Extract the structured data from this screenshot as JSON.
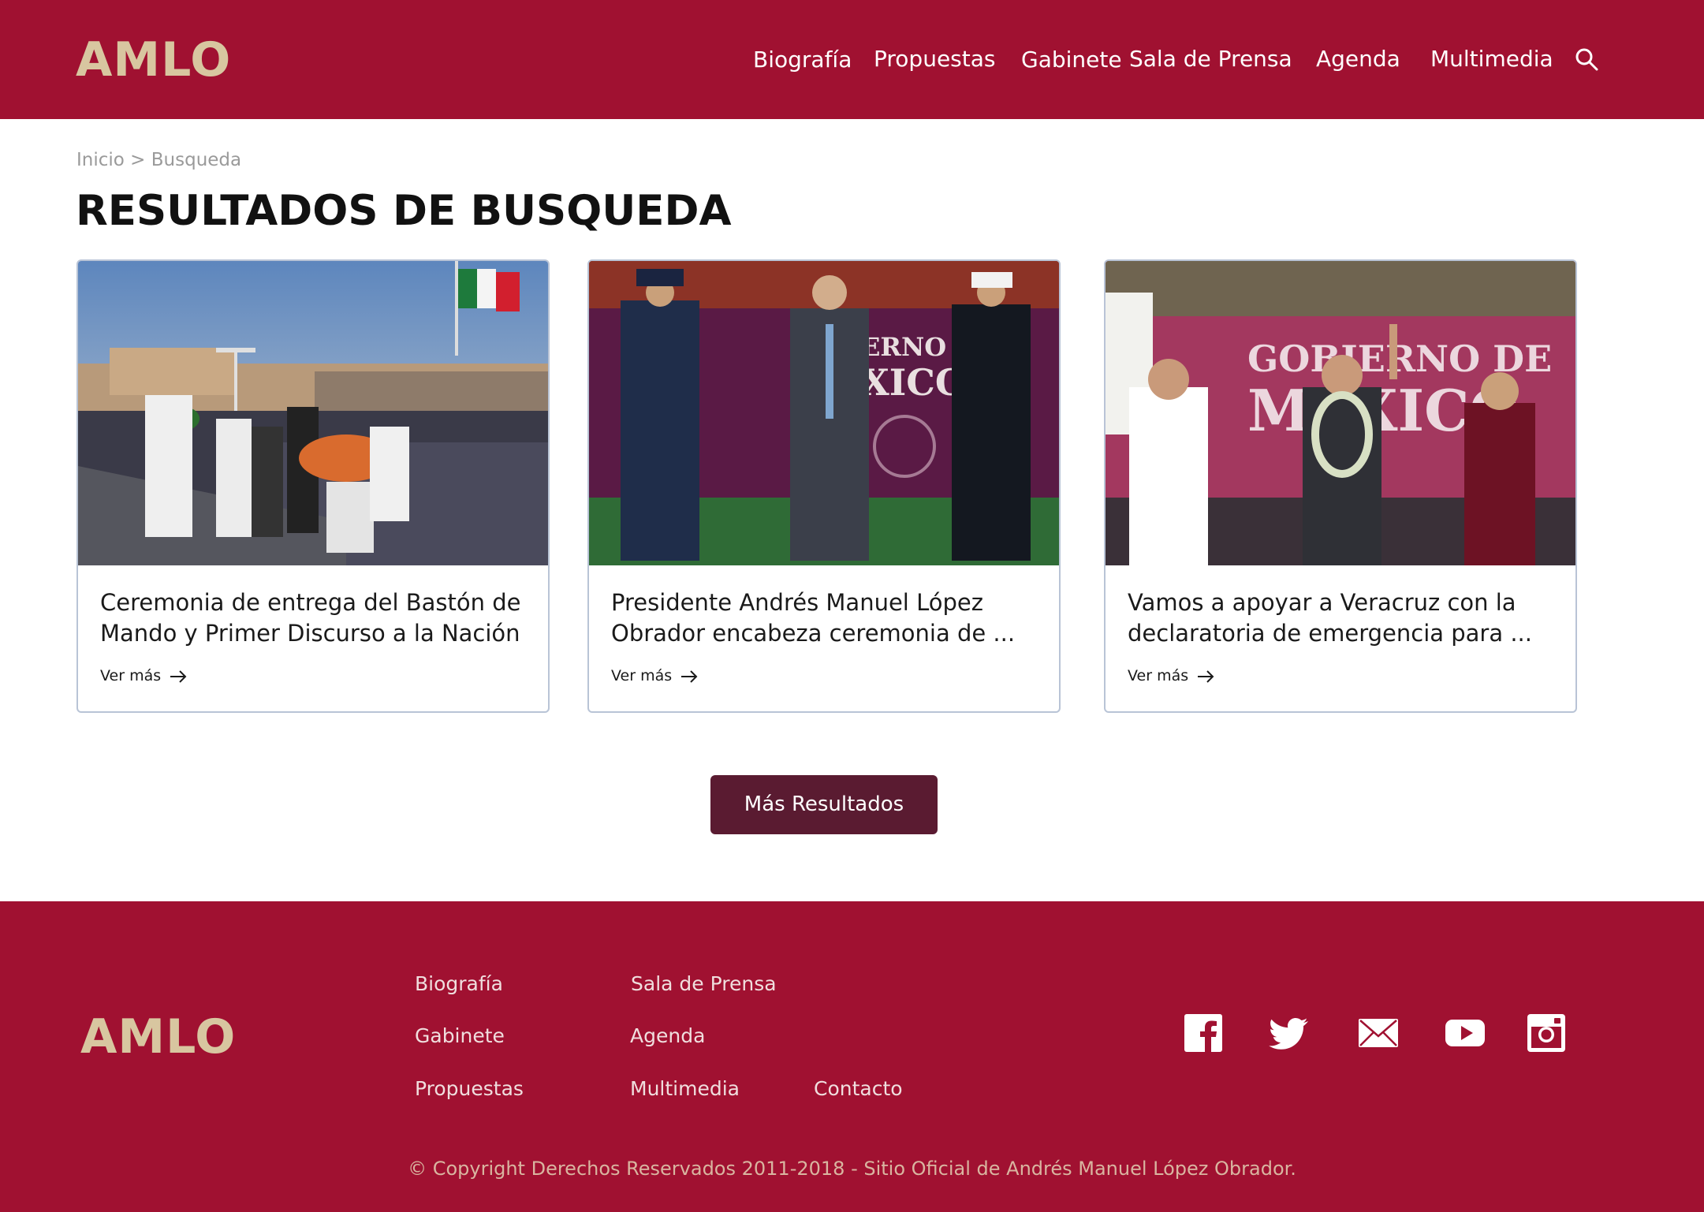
{
  "header": {
    "logo": "AMLO",
    "nav": [
      "Biografía",
      "Propuestas",
      "Gabinete",
      "Sala de Prensa",
      "Agenda",
      "Multimedia"
    ]
  },
  "breadcrumb": {
    "home": "Inicio",
    "separator": ">",
    "current": "Busqueda"
  },
  "page_title": "RESULTADOS DE BUSQUEDA",
  "cards": [
    {
      "title": "Ceremonia de entrega del Bastón de Mando y Primer Discurso a la Nación",
      "link": "Ver más"
    },
    {
      "title": "Presidente Andrés Manuel López Obrador encabeza ceremonia de ...",
      "link": "Ver más"
    },
    {
      "title": "Vamos a apoyar a Veracruz con la declaratoria de emergencia para ...",
      "link": "Ver más"
    }
  ],
  "card_image_texts": {
    "card2_banner": "ERNO D\nXICO",
    "card3_banner": "GOBIERNO DE\nMEXICO"
  },
  "more_button": "Más Resultados",
  "footer": {
    "logo": "AMLO",
    "links": [
      "Biografía",
      "Sala de Prensa",
      "Gabinete",
      "Agenda",
      "Propuestas",
      "Multimedia",
      "Contacto"
    ],
    "social": [
      "facebook-icon",
      "twitter-icon",
      "mail-icon",
      "youtube-icon",
      "instagram-icon"
    ],
    "copyright": "© Copyright Derechos Reservados 2011-2018 - Sitio Oficial de Andrés Manuel López Obrador."
  },
  "colors": {
    "brand": "#a01131",
    "logo": "#d8c6a0",
    "button": "#5a1b31"
  }
}
